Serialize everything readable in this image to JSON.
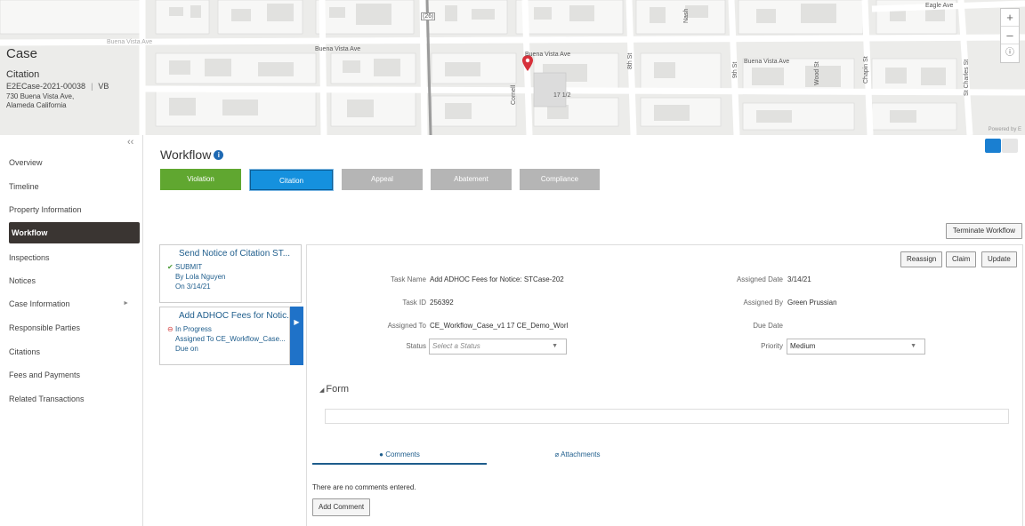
{
  "map": {
    "streets": [
      "Buena Vista Ave",
      "Buena Vista Ave",
      "Buena Vista Ave",
      "Buena Vista Ave",
      "Eagle Ave",
      "Nash",
      "8th St",
      "9th St",
      "Wood St",
      "Chapin St",
      "St Charles St",
      "Cornell",
      "17 1/2",
      "(26)"
    ],
    "zoom_in": "+",
    "zoom_out": "–",
    "info": "ⓘ",
    "powered": "Powered by E",
    "pin_color": "#d6303a"
  },
  "case": {
    "title": "Case",
    "type": "Citation",
    "id": "E2ECase-2021-00038",
    "code": "VB",
    "address_line1": "730 Buena Vista Ave,",
    "address_line2": "Alameda California"
  },
  "sidebar": {
    "collapse": "‹‹",
    "items": [
      {
        "label": "Overview"
      },
      {
        "label": "Timeline"
      },
      {
        "label": "Property Information"
      },
      {
        "label": "Workflow"
      },
      {
        "label": "Inspections"
      },
      {
        "label": "Notices"
      },
      {
        "label": "Case Information"
      },
      {
        "label": "Responsible Parties"
      },
      {
        "label": "Citations"
      },
      {
        "label": "Fees and Payments"
      },
      {
        "label": "Related Transactions"
      }
    ],
    "caret": "►"
  },
  "workflow": {
    "title": "Workflow",
    "info": "i",
    "stages": [
      "Violation",
      "Citation",
      "Appeal",
      "Abatement",
      "Compliance"
    ],
    "terminate": "Terminate Workflow",
    "colors": {
      "complete": "#60a730",
      "current": "#1591de",
      "pending": "#b5b5b5"
    }
  },
  "cards": [
    {
      "title": "Send Notice of Citation ST...",
      "icon": "✔",
      "status": "SUBMIT",
      "line2": "By Lola Nguyen",
      "line3": "On 3/14/21"
    },
    {
      "title": "Add ADHOC Fees for Notic...",
      "icon": "⊖",
      "status": "In Progress",
      "line2": "Assigned To CE_Workflow_Case...",
      "line3": "Due on"
    }
  ],
  "card_arrow": "▶",
  "detail": {
    "buttons": [
      "Reassign",
      "Claim",
      "Update"
    ],
    "task_name_label": "Task Name",
    "task_name": "Add ADHOC Fees for Notice: STCase-202",
    "task_id_label": "Task ID",
    "task_id": "256392",
    "assigned_to_label": "Assigned To",
    "assigned_to": "CE_Workflow_Case_v1 17 CE_Demo_Worl",
    "status_label": "Status",
    "status_placeholder": "Select a Status",
    "assigned_date_label": "Assigned Date",
    "assigned_date": "3/14/21",
    "assigned_by_label": "Assigned By",
    "assigned_by": "Green Prussian",
    "due_date_label": "Due Date",
    "due_date": "",
    "priority_label": "Priority",
    "priority": "Medium",
    "select_arrow": "▼"
  },
  "form": {
    "title": "Form",
    "toggle": "◢"
  },
  "tabs": [
    {
      "icon": "●",
      "label": "Comments"
    },
    {
      "icon": "⌀",
      "label": "Attachments"
    }
  ],
  "comments": {
    "empty": "There are no comments entered.",
    "add": "Add Comment"
  }
}
